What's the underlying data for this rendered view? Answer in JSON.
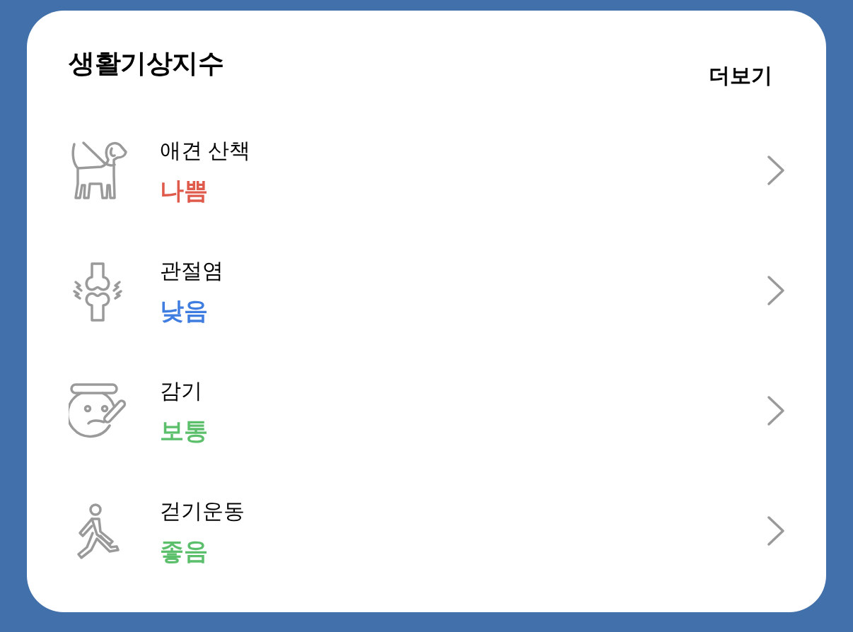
{
  "title": "생활기상지수",
  "more_link": "더보기",
  "items": [
    {
      "kind": "dog",
      "label": "애견 산책",
      "value": "나쁨",
      "color": "#e05a4c"
    },
    {
      "kind": "joint",
      "label": "관절염",
      "value": "낮음",
      "color": "#3f7de0"
    },
    {
      "kind": "cold",
      "label": "감기",
      "value": "보통",
      "color": "#5cbf6c"
    },
    {
      "kind": "walk",
      "label": "걷기운동",
      "value": "좋음",
      "color": "#5cbf6c"
    }
  ]
}
